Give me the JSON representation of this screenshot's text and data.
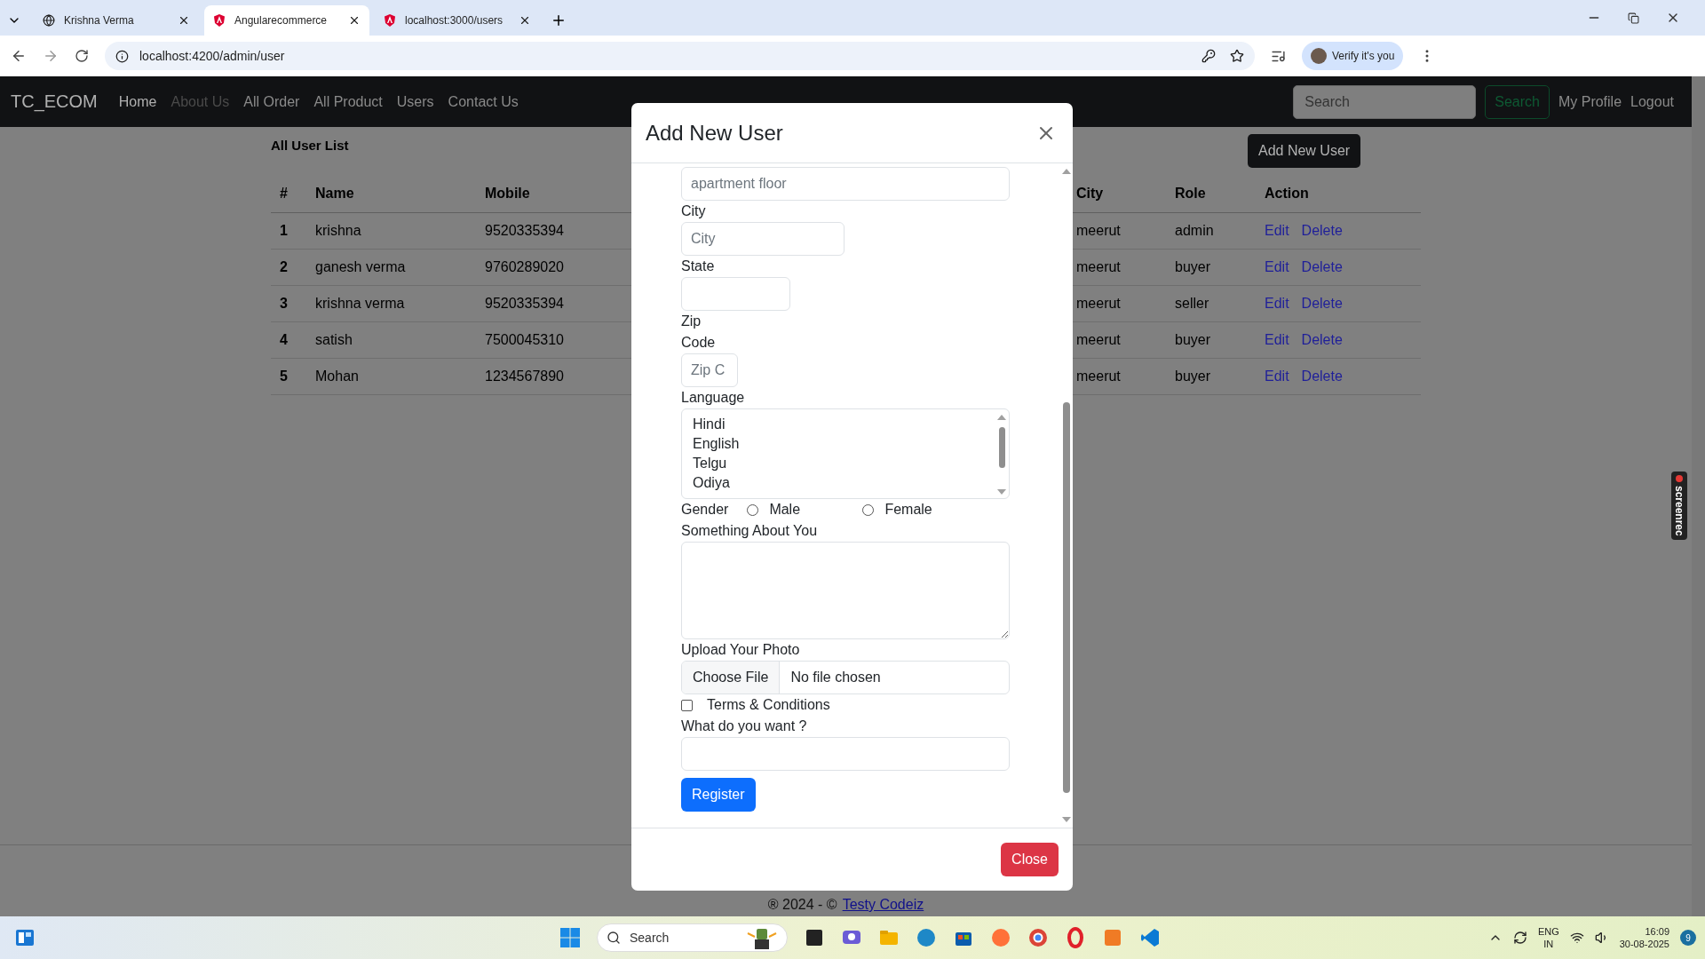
{
  "browser": {
    "tabs": [
      {
        "title": "Krishna Verma",
        "selected": false
      },
      {
        "title": "Angularecommerce",
        "selected": true
      },
      {
        "title": "localhost:3000/users",
        "selected": false
      }
    ],
    "url": "localhost:4200/admin/user",
    "profile_button": "Verify it's you"
  },
  "navbar": {
    "brand": "TC_ECOM",
    "links": [
      {
        "label": "Home",
        "active": true,
        "disabled": false
      },
      {
        "label": "About Us",
        "active": false,
        "disabled": true
      },
      {
        "label": "All Order",
        "active": false,
        "disabled": false
      },
      {
        "label": "All Product",
        "active": false,
        "disabled": false
      },
      {
        "label": "Users",
        "active": false,
        "disabled": false
      },
      {
        "label": "Contact Us",
        "active": false,
        "disabled": false
      }
    ],
    "search": {
      "placeholder": "Search"
    },
    "search_button": "Search",
    "user_links": [
      "My Profile",
      "Logout"
    ]
  },
  "page": {
    "title": "All User List",
    "add_button": "Add New User",
    "table": {
      "columns": [
        "#",
        "Name",
        "Mobile",
        "City",
        "Role",
        "Action"
      ],
      "rows": [
        {
          "index": "1",
          "name": "krishna",
          "mobile": "9520335394",
          "city": "meerut",
          "role": "admin",
          "actions": [
            "Edit",
            "Delete"
          ]
        },
        {
          "index": "2",
          "name": "ganesh verma",
          "mobile": "9760289020",
          "city": "meerut",
          "role": "buyer",
          "actions": [
            "Edit",
            "Delete"
          ]
        },
        {
          "index": "3",
          "name": "krishna verma",
          "mobile": "9520335394",
          "city": "meerut",
          "role": "seller",
          "actions": [
            "Edit",
            "Delete"
          ]
        },
        {
          "index": "4",
          "name": "satish",
          "mobile": "7500045310",
          "city": "meerut",
          "role": "buyer",
          "actions": [
            "Edit",
            "Delete"
          ]
        },
        {
          "index": "5",
          "name": "Mohan",
          "mobile": "1234567890",
          "city": "meerut",
          "role": "buyer",
          "actions": [
            "Edit",
            "Delete"
          ]
        }
      ]
    }
  },
  "footer": {
    "text": "® 2024 - ©",
    "link": "Testy Codeiz"
  },
  "modal": {
    "title": "Add New User",
    "form": {
      "address_line": {
        "placeholder": "apartment floor"
      },
      "city": {
        "label": "City",
        "placeholder": "City"
      },
      "state": {
        "label": "State"
      },
      "zip": {
        "label": "Zip Code",
        "placeholder": "Zip C"
      },
      "language": {
        "label": "Language",
        "options": [
          {
            "label": "Hindi",
            "selected": false
          },
          {
            "label": "English",
            "selected": false
          },
          {
            "label": "Telgu",
            "selected": false
          },
          {
            "label": "Odiya",
            "selected": false
          }
        ]
      },
      "gender": {
        "label": "Gender",
        "options": [
          {
            "label": "Male",
            "selected": false
          },
          {
            "label": "Female",
            "selected": false
          }
        ]
      },
      "about": {
        "label": "Something About You"
      },
      "photo": {
        "label": "Upload Your Photo",
        "button": "Choose File",
        "status": "No file chosen"
      },
      "terms": {
        "label": "Terms & Conditions",
        "checked": false
      },
      "want": {
        "label": "What do you want ?"
      },
      "submit": "Register"
    },
    "close_button": "Close"
  },
  "screen_recorder": {
    "label": "screenrec"
  },
  "taskbar": {
    "search": {
      "placeholder": "Search"
    },
    "tray": {
      "language": "ENG",
      "region": "IN",
      "time": "16:09",
      "date": "30-08-2025",
      "notifications": "9"
    }
  }
}
